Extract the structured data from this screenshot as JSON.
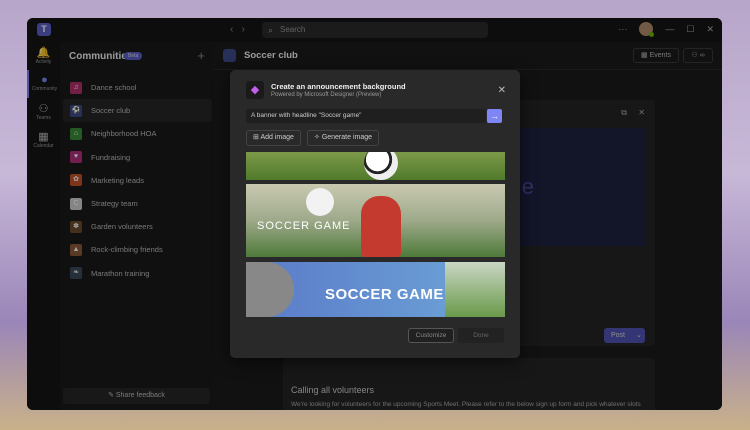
{
  "titlebar": {
    "search_placeholder": "Search",
    "more": "···",
    "minimize": "—",
    "maximize": "☐",
    "close": "✕"
  },
  "rail": [
    {
      "label": "Activity",
      "icon": "bell-icon",
      "glyph": "🔔"
    },
    {
      "label": "Community",
      "icon": "community-icon",
      "glyph": "●"
    },
    {
      "label": "Teams",
      "icon": "teams-icon",
      "glyph": "⚇"
    },
    {
      "label": "Calendar",
      "icon": "calendar-icon",
      "glyph": "▦"
    }
  ],
  "sidebar": {
    "title": "Communities",
    "badge": "Beta",
    "feedback": "Share feedback",
    "items": [
      {
        "label": "Dance school",
        "color": "#b0306a",
        "glyph": "♫"
      },
      {
        "label": "Soccer club",
        "color": "#3e4a8a",
        "glyph": "⚽"
      },
      {
        "label": "Neighborhood HOA",
        "color": "#3a8a3a",
        "glyph": "⌂"
      },
      {
        "label": "Fundraising",
        "color": "#b0307a",
        "glyph": "♥"
      },
      {
        "label": "Marketing leads",
        "color": "#c0502a",
        "glyph": "✿"
      },
      {
        "label": "Strategy team",
        "color": "#cccccc",
        "glyph": "C"
      },
      {
        "label": "Garden volunteers",
        "color": "#6a4a2a",
        "glyph": "✽"
      },
      {
        "label": "Rock-climbing friends",
        "color": "#8a5a3a",
        "glyph": "▲"
      },
      {
        "label": "Marathon training",
        "color": "#3a4a5a",
        "glyph": "❧"
      }
    ]
  },
  "main": {
    "title": "Soccer club",
    "events": "Events",
    "post": "Post",
    "post_card": {
      "title": "Calling all volunteers",
      "body": "We're looking for volunteers for the upcoming Sports Meet. Please refer to the below sign up form and pick whatever slots you can help with!"
    }
  },
  "modal": {
    "title": "Create an announcement background",
    "subtitle": "Powered by Microsoft Designer (Preview)",
    "prompt": "A banner with headline \"Soccer game\"",
    "add_image": "Add image",
    "generate_image": "Generate image",
    "option2_text": "SOCCER GAME",
    "option3_text": "SOCCER GAME",
    "customize": "Customize",
    "done": "Done"
  }
}
